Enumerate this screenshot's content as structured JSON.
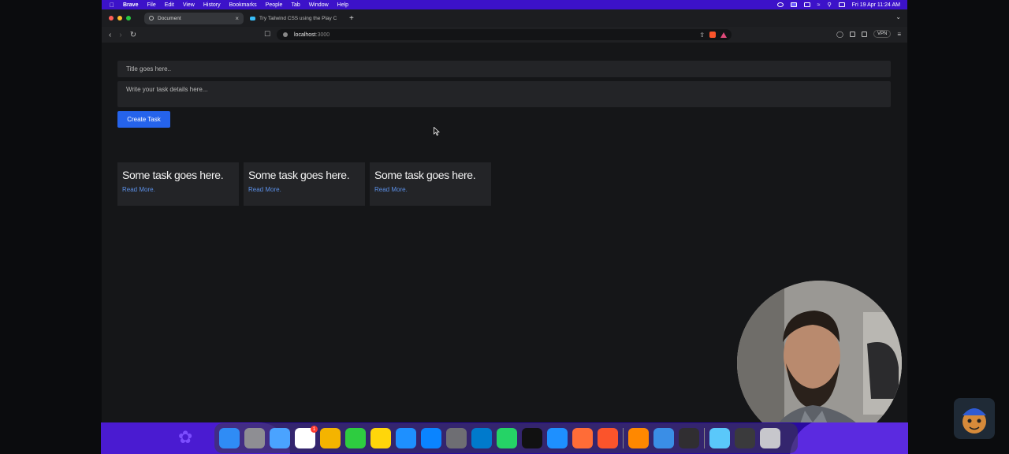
{
  "menubar": {
    "app_name": "Brave",
    "menus": [
      "File",
      "Edit",
      "View",
      "History",
      "Bookmarks",
      "People",
      "Tab",
      "Window",
      "Help"
    ],
    "datetime": "Fri 19 Apr  11:24 AM"
  },
  "tabs": [
    {
      "title": "Document",
      "active": true
    },
    {
      "title": "Try Tailwind CSS using the Play C",
      "active": false
    }
  ],
  "toolbar": {
    "url_host": "localhost",
    "url_port": ":3000",
    "vpn_label": "VPN"
  },
  "form": {
    "title_placeholder": "Title goes here..",
    "details_placeholder": "Write your task details here...",
    "create_label": "Create Task"
  },
  "tasks": [
    {
      "title": "Some task goes here.",
      "link": "Read More."
    },
    {
      "title": "Some task goes here.",
      "link": "Read More."
    },
    {
      "title": "Some task goes here.",
      "link": "Read More."
    }
  ],
  "dock": {
    "apps": [
      {
        "icon": "finder-icon",
        "color": "#2f8cf5"
      },
      {
        "icon": "launchpad-icon",
        "color": "#8e8e93"
      },
      {
        "icon": "app-store-alt-icon",
        "color": "#4aa3ff"
      },
      {
        "icon": "reminders-icon",
        "color": "#ffffff",
        "badge": "1"
      },
      {
        "icon": "photos-icon",
        "color": "#f4b400"
      },
      {
        "icon": "facetime-icon",
        "color": "#2ecc40"
      },
      {
        "icon": "notes-icon",
        "color": "#ffd60a"
      },
      {
        "icon": "keynote-icon",
        "color": "#1e90ff"
      },
      {
        "icon": "app-store-icon",
        "color": "#0a84ff"
      },
      {
        "icon": "system-settings-icon",
        "color": "#6e6e73"
      },
      {
        "icon": "vscode-icon",
        "color": "#007acc"
      },
      {
        "icon": "whatsapp-icon",
        "color": "#25d366"
      },
      {
        "icon": "github-desktop-icon",
        "color": "#111111"
      },
      {
        "icon": "safari-icon",
        "color": "#1e90ff"
      },
      {
        "icon": "postman-icon",
        "color": "#ff6c37"
      },
      {
        "icon": "brave-icon",
        "color": "#fb542b"
      },
      {
        "icon": "vlc-icon",
        "color": "#ff8800"
      },
      {
        "icon": "preview-icon",
        "color": "#3a8ee6"
      },
      {
        "icon": "obs-icon",
        "color": "#302e31"
      },
      {
        "icon": "downloads-folder-icon",
        "color": "#5ac8fa"
      },
      {
        "icon": "screen-recorder-icon",
        "color": "#3a3a3c"
      },
      {
        "icon": "trash-icon",
        "color": "#c7c7cc"
      }
    ]
  }
}
